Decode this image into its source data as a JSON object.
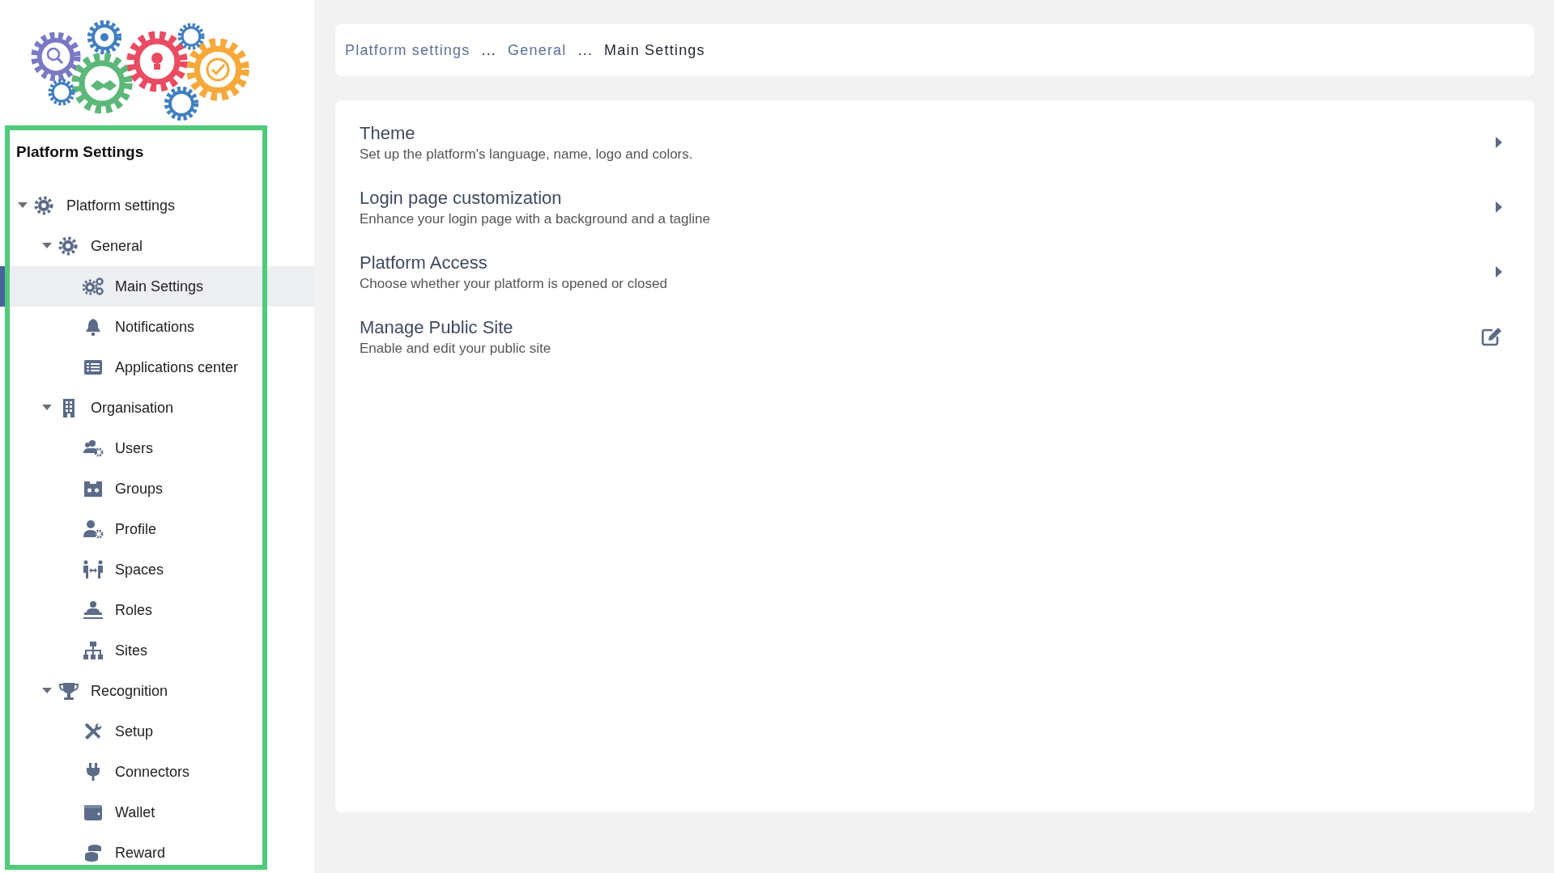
{
  "sidebar": {
    "title": "Platform Settings",
    "tree": [
      {
        "label": "Platform settings",
        "expanded": true,
        "selected": false,
        "children": [
          {
            "label": "General",
            "expanded": true,
            "selected": false,
            "children": [
              {
                "label": "Main Settings",
                "selected": true
              },
              {
                "label": "Notifications",
                "selected": false
              },
              {
                "label": "Applications center",
                "selected": false
              }
            ]
          },
          {
            "label": "Organisation",
            "expanded": true,
            "selected": false,
            "children": [
              {
                "label": "Users",
                "selected": false
              },
              {
                "label": "Groups",
                "selected": false
              },
              {
                "label": "Profile",
                "selected": false
              },
              {
                "label": "Spaces",
                "selected": false
              },
              {
                "label": "Roles",
                "selected": false
              },
              {
                "label": "Sites",
                "selected": false
              }
            ]
          },
          {
            "label": "Recognition",
            "expanded": true,
            "selected": false,
            "children": [
              {
                "label": "Setup",
                "selected": false
              },
              {
                "label": "Connectors",
                "selected": false
              },
              {
                "label": "Wallet",
                "selected": false
              },
              {
                "label": "Reward",
                "selected": false
              }
            ]
          }
        ]
      }
    ]
  },
  "breadcrumb": [
    {
      "label": "Platform settings",
      "kind": "link"
    },
    {
      "label": "...",
      "kind": "separator"
    },
    {
      "label": "General",
      "kind": "link"
    },
    {
      "label": "...",
      "kind": "separator"
    },
    {
      "label": "Main Settings",
      "kind": "current"
    }
  ],
  "settings": [
    {
      "title": "Theme",
      "description": "Set up the platform's language, name, logo and colors.",
      "kind": "expand"
    },
    {
      "title": "Login page customization",
      "description": "Enhance your login page with a background and a tagline",
      "kind": "expand"
    },
    {
      "title": "Platform Access",
      "description": "Choose whether your platform is opened or closed",
      "kind": "expand"
    },
    {
      "title": "Manage Public Site",
      "description": "Enable and edit your public site",
      "kind": "edit"
    }
  ]
}
